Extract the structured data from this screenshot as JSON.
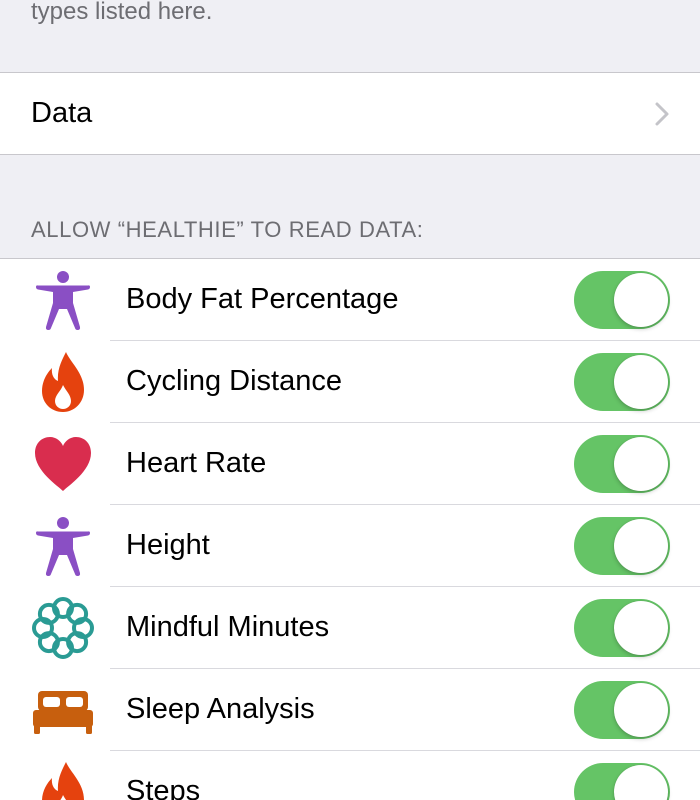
{
  "intro": {
    "text": "types listed here."
  },
  "data_row": {
    "label": "Data",
    "chevron_icon": "chevron-right-icon"
  },
  "section": {
    "header": "ALLOW “HEALTHIE” TO READ DATA:"
  },
  "colors": {
    "toggle_on": "#65c466",
    "activity_purple": "#8a4fc4",
    "fire_orange": "#e5420e",
    "heart_red": "#d92d4e",
    "mindful_teal": "#2a9b94",
    "sleep_orange": "#c75f0e"
  },
  "permissions": [
    {
      "label": "Body Fat Percentage",
      "icon": "body-figure-icon",
      "enabled": true
    },
    {
      "label": "Cycling Distance",
      "icon": "flame-icon",
      "enabled": true
    },
    {
      "label": "Heart Rate",
      "icon": "heart-icon",
      "enabled": true
    },
    {
      "label": "Height",
      "icon": "body-figure-icon",
      "enabled": true
    },
    {
      "label": "Mindful Minutes",
      "icon": "mindful-flower-icon",
      "enabled": true
    },
    {
      "label": "Sleep Analysis",
      "icon": "bed-icon",
      "enabled": true
    },
    {
      "label": "Steps",
      "icon": "flame-icon",
      "enabled": true
    }
  ]
}
